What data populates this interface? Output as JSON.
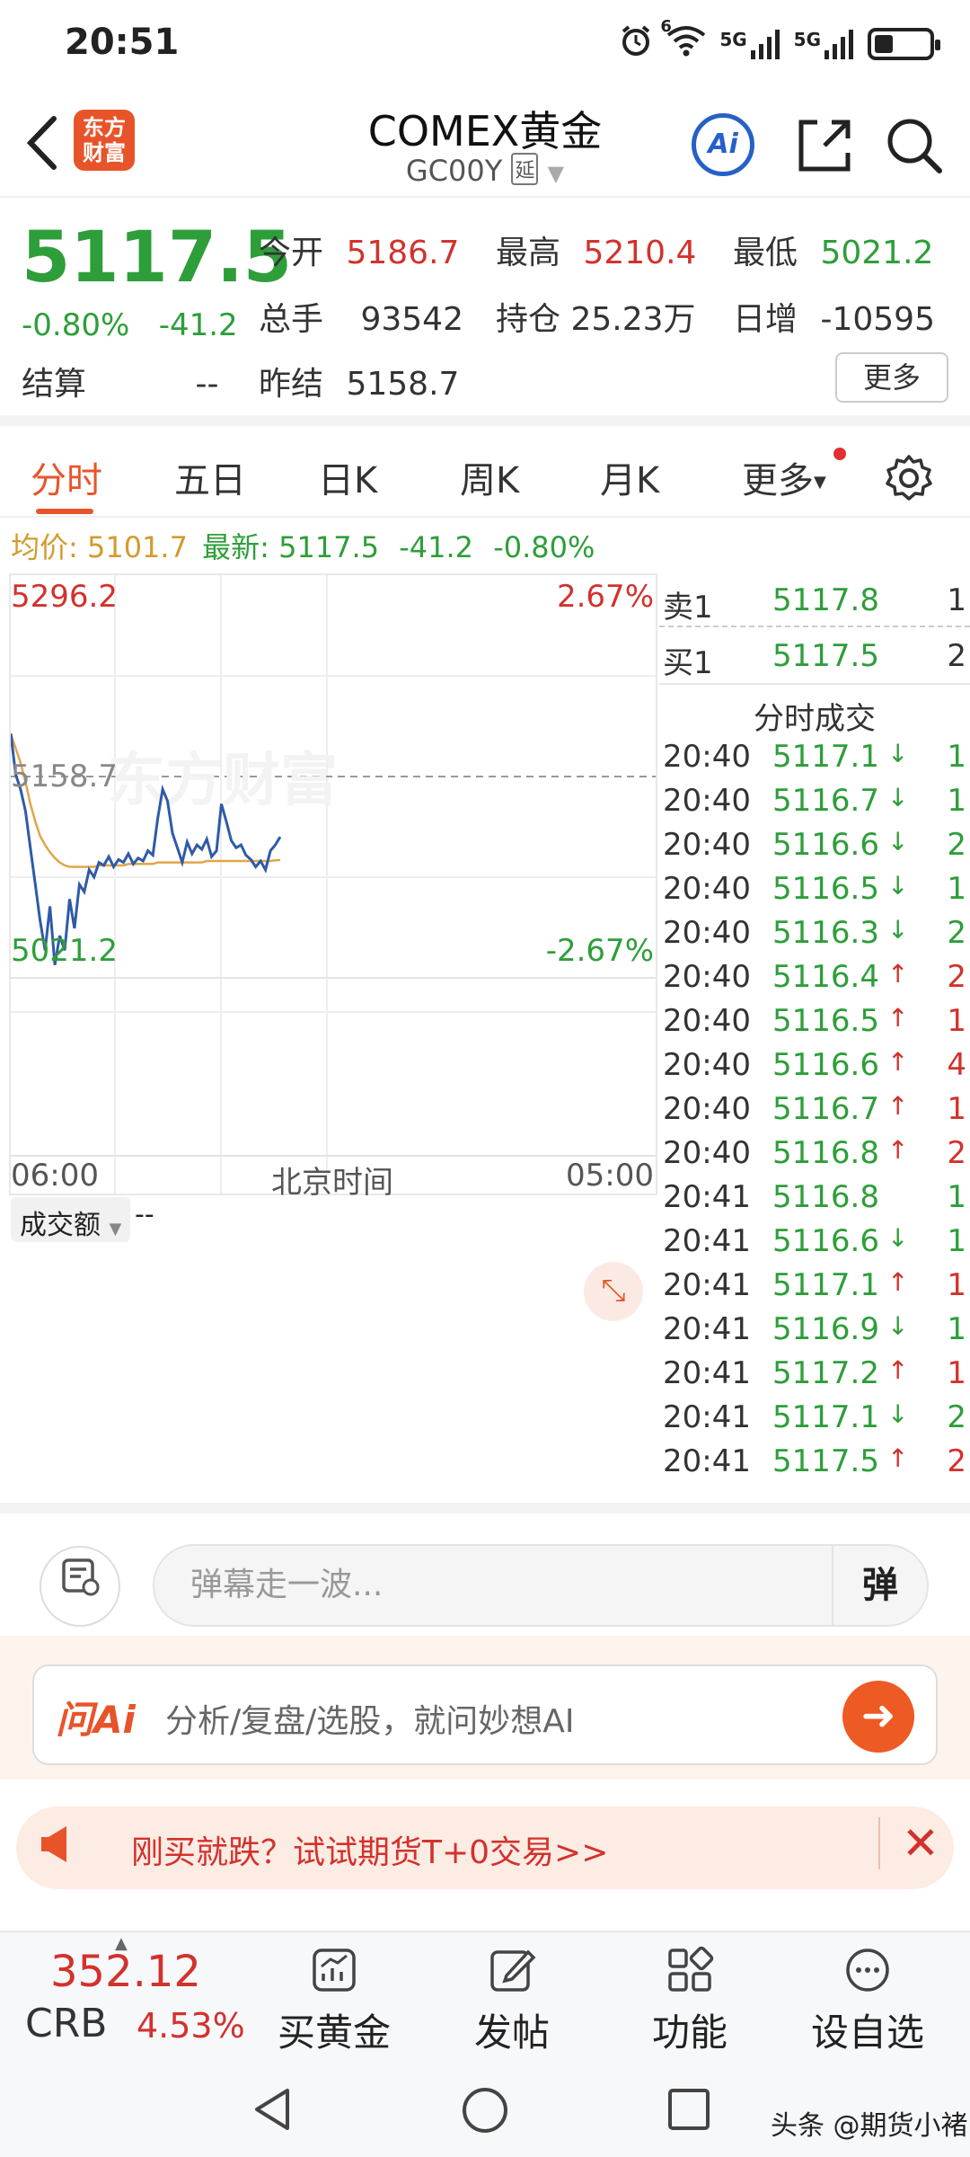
{
  "status_bar": {
    "time": "20:51",
    "icons": [
      "alarm-icon",
      "wifi-icon",
      "signal-5g-icon",
      "signal-5g-icon",
      "battery-icon"
    ],
    "wifi_tag": "6",
    "net1": "5G",
    "net2": "5G"
  },
  "header": {
    "back": "back-icon",
    "logo_line1": "东方",
    "logo_line2": "财富",
    "title": "COMEX黄金",
    "code": "GC00Y",
    "delay_tag": "延",
    "ai_label": "Ai"
  },
  "quote": {
    "price": "5117.5",
    "pct": "-0.80%",
    "change": "-41.2",
    "open_label": "今开",
    "open": "5186.7",
    "high_label": "最高",
    "high": "5210.4",
    "low_label": "最低",
    "low": "5021.2",
    "volume_label": "总手",
    "volume": "93542",
    "oi_label": "持仓",
    "oi": "25.23万",
    "daily_label": "日增",
    "daily": "-10595",
    "settle_label": "结算",
    "settle": "--",
    "prev_settle_label": "昨结",
    "prev_settle": "5158.7",
    "more_label": "更多"
  },
  "tabs": [
    "分时",
    "五日",
    "日K",
    "周K",
    "月K",
    "更多"
  ],
  "avg_bar": {
    "avg_label": "均价:",
    "avg": "5101.7",
    "latest_label": "最新:",
    "latest": "5117.5",
    "chg": "-41.2",
    "pct": "-0.80%"
  },
  "chart": {
    "y_high": "5296.2",
    "y_high_pct": "2.67%",
    "y_mid": "5158.7",
    "y_low": "5021.2",
    "y_low_pct": "-2.67%",
    "watermark": "东方财富",
    "volume_label": "成交额",
    "volume_value": "--",
    "time_start": "06:00",
    "time_mid": "北京时间",
    "time_end": "05:00"
  },
  "order_book": [
    {
      "side": "卖1",
      "price": "5117.8",
      "qty": "1"
    },
    {
      "side": "买1",
      "price": "5117.5",
      "qty": "2"
    }
  ],
  "trades_title": "分时成交",
  "trades": [
    {
      "time": "20:40",
      "price": "5117.1",
      "dir": "↓",
      "qty": "1"
    },
    {
      "time": "20:40",
      "price": "5116.7",
      "dir": "↓",
      "qty": "1"
    },
    {
      "time": "20:40",
      "price": "5116.6",
      "dir": "↓",
      "qty": "2"
    },
    {
      "time": "20:40",
      "price": "5116.5",
      "dir": "↓",
      "qty": "1"
    },
    {
      "time": "20:40",
      "price": "5116.3",
      "dir": "↓",
      "qty": "2"
    },
    {
      "time": "20:40",
      "price": "5116.4",
      "dir": "↑",
      "qty": "2"
    },
    {
      "time": "20:40",
      "price": "5116.5",
      "dir": "↑",
      "qty": "1"
    },
    {
      "time": "20:40",
      "price": "5116.6",
      "dir": "↑",
      "qty": "4"
    },
    {
      "time": "20:40",
      "price": "5116.7",
      "dir": "↑",
      "qty": "1"
    },
    {
      "time": "20:40",
      "price": "5116.8",
      "dir": "↑",
      "qty": "2"
    },
    {
      "time": "20:41",
      "price": "5116.8",
      "dir": "",
      "qty": "1"
    },
    {
      "time": "20:41",
      "price": "5116.6",
      "dir": "↓",
      "qty": "1"
    },
    {
      "time": "20:41",
      "price": "5117.1",
      "dir": "↑",
      "qty": "1"
    },
    {
      "time": "20:41",
      "price": "5116.9",
      "dir": "↓",
      "qty": "1"
    },
    {
      "time": "20:41",
      "price": "5117.2",
      "dir": "↑",
      "qty": "1"
    },
    {
      "time": "20:41",
      "price": "5117.1",
      "dir": "↓",
      "qty": "2"
    },
    {
      "time": "20:41",
      "price": "5117.5",
      "dir": "↑",
      "qty": "2"
    }
  ],
  "comment": {
    "placeholder": "弹幕走一波...",
    "danmu_btn": "弹"
  },
  "ai_prompt": {
    "logo": "问Ai",
    "text": "分析/复盘/选股，就问妙想AI"
  },
  "promo": {
    "text": "刚买就跌？试试期货T+0交易>>"
  },
  "bottom_nav": {
    "crb_value": "352.12",
    "crb_name": "CRB",
    "crb_pct": "4.53%",
    "items": [
      "买黄金",
      "发帖",
      "功能",
      "设自选"
    ]
  },
  "watermark_corner": "头条 @期货小褚",
  "colors": {
    "up": "#d2322d",
    "down": "#2e9e3a",
    "accent": "#e8542a",
    "price_line": "#2f5aa8",
    "avg_line": "#e0a64a"
  },
  "chart_data": {
    "type": "line",
    "x_start": "06:00",
    "x_end": "05:00",
    "ylim": [
      5021.2,
      5296.2
    ],
    "reference": 5158.7,
    "series": [
      {
        "values": [
          5188,
          5160,
          5150,
          5135,
          5110,
          5085,
          5060,
          5040,
          5070,
          5030,
          5050,
          5040,
          5075,
          5055,
          5085,
          5080,
          5095,
          5090,
          5100,
          5098,
          5104,
          5097,
          5102,
          5100,
          5106,
          5099,
          5103,
          5101,
          5108,
          5105,
          5130,
          5150,
          5142,
          5120,
          5110,
          5100,
          5114,
          5106,
          5112,
          5109,
          5116,
          5104,
          5108,
          5140,
          5128,
          5115,
          5110,
          5112,
          5105,
          5102,
          5097,
          5101,
          5095,
          5108,
          5112,
          5117.5
        ]
      },
      {
        "values": [
          5188,
          5178,
          5168,
          5155,
          5140,
          5128,
          5118,
          5112,
          5107,
          5103,
          5100,
          5098,
          5097,
          5097,
          5097,
          5097,
          5097,
          5097,
          5098,
          5098,
          5098,
          5098,
          5098,
          5098,
          5099,
          5099,
          5099,
          5099,
          5099,
          5099,
          5100,
          5100,
          5100,
          5100,
          5100,
          5100,
          5100,
          5100,
          5100,
          5100,
          5101,
          5101,
          5101,
          5101,
          5101,
          5101,
          5101,
          5101,
          5101,
          5101,
          5101,
          5101,
          5101,
          5101,
          5101.5,
          5101.7
        ]
      }
    ]
  }
}
